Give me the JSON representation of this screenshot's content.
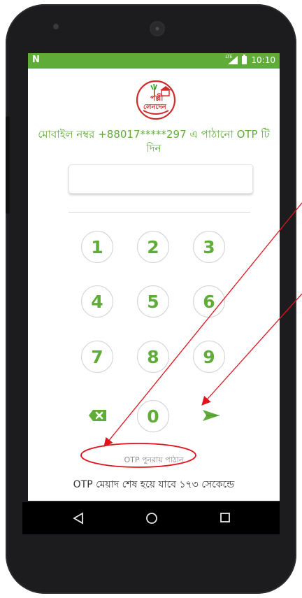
{
  "status_bar": {
    "left_icon": "N",
    "network": "LTE",
    "time": "10:10"
  },
  "logo": {
    "name": "পল্লী লেনদেন",
    "line1": "পল্লী",
    "line2": "লেনদেন"
  },
  "otp_prompt": "মোবাইল নম্বর +88017*****297 এ পাঠানো OTP টি দিন",
  "otp_input": {
    "value": "",
    "placeholder": ""
  },
  "keypad": {
    "keys": [
      "1",
      "2",
      "3",
      "4",
      "5",
      "6",
      "7",
      "8",
      "9",
      "0"
    ],
    "backspace_icon": "backspace-icon",
    "submit_icon": "send-icon"
  },
  "resend_label": "OTP পুনরায় পাঠান",
  "expiry_text": "OTP মেয়াদ শেষ হয়ে যাবে ১৭৩ সেকেন্ডে",
  "nav_bar": {
    "back_icon": "back-triangle-icon",
    "home_icon": "home-circle-icon",
    "recents_icon": "recents-square-icon"
  },
  "colors": {
    "accent": "#5fad38",
    "annotation": "#e0141e",
    "device": "#1c1c1e"
  }
}
